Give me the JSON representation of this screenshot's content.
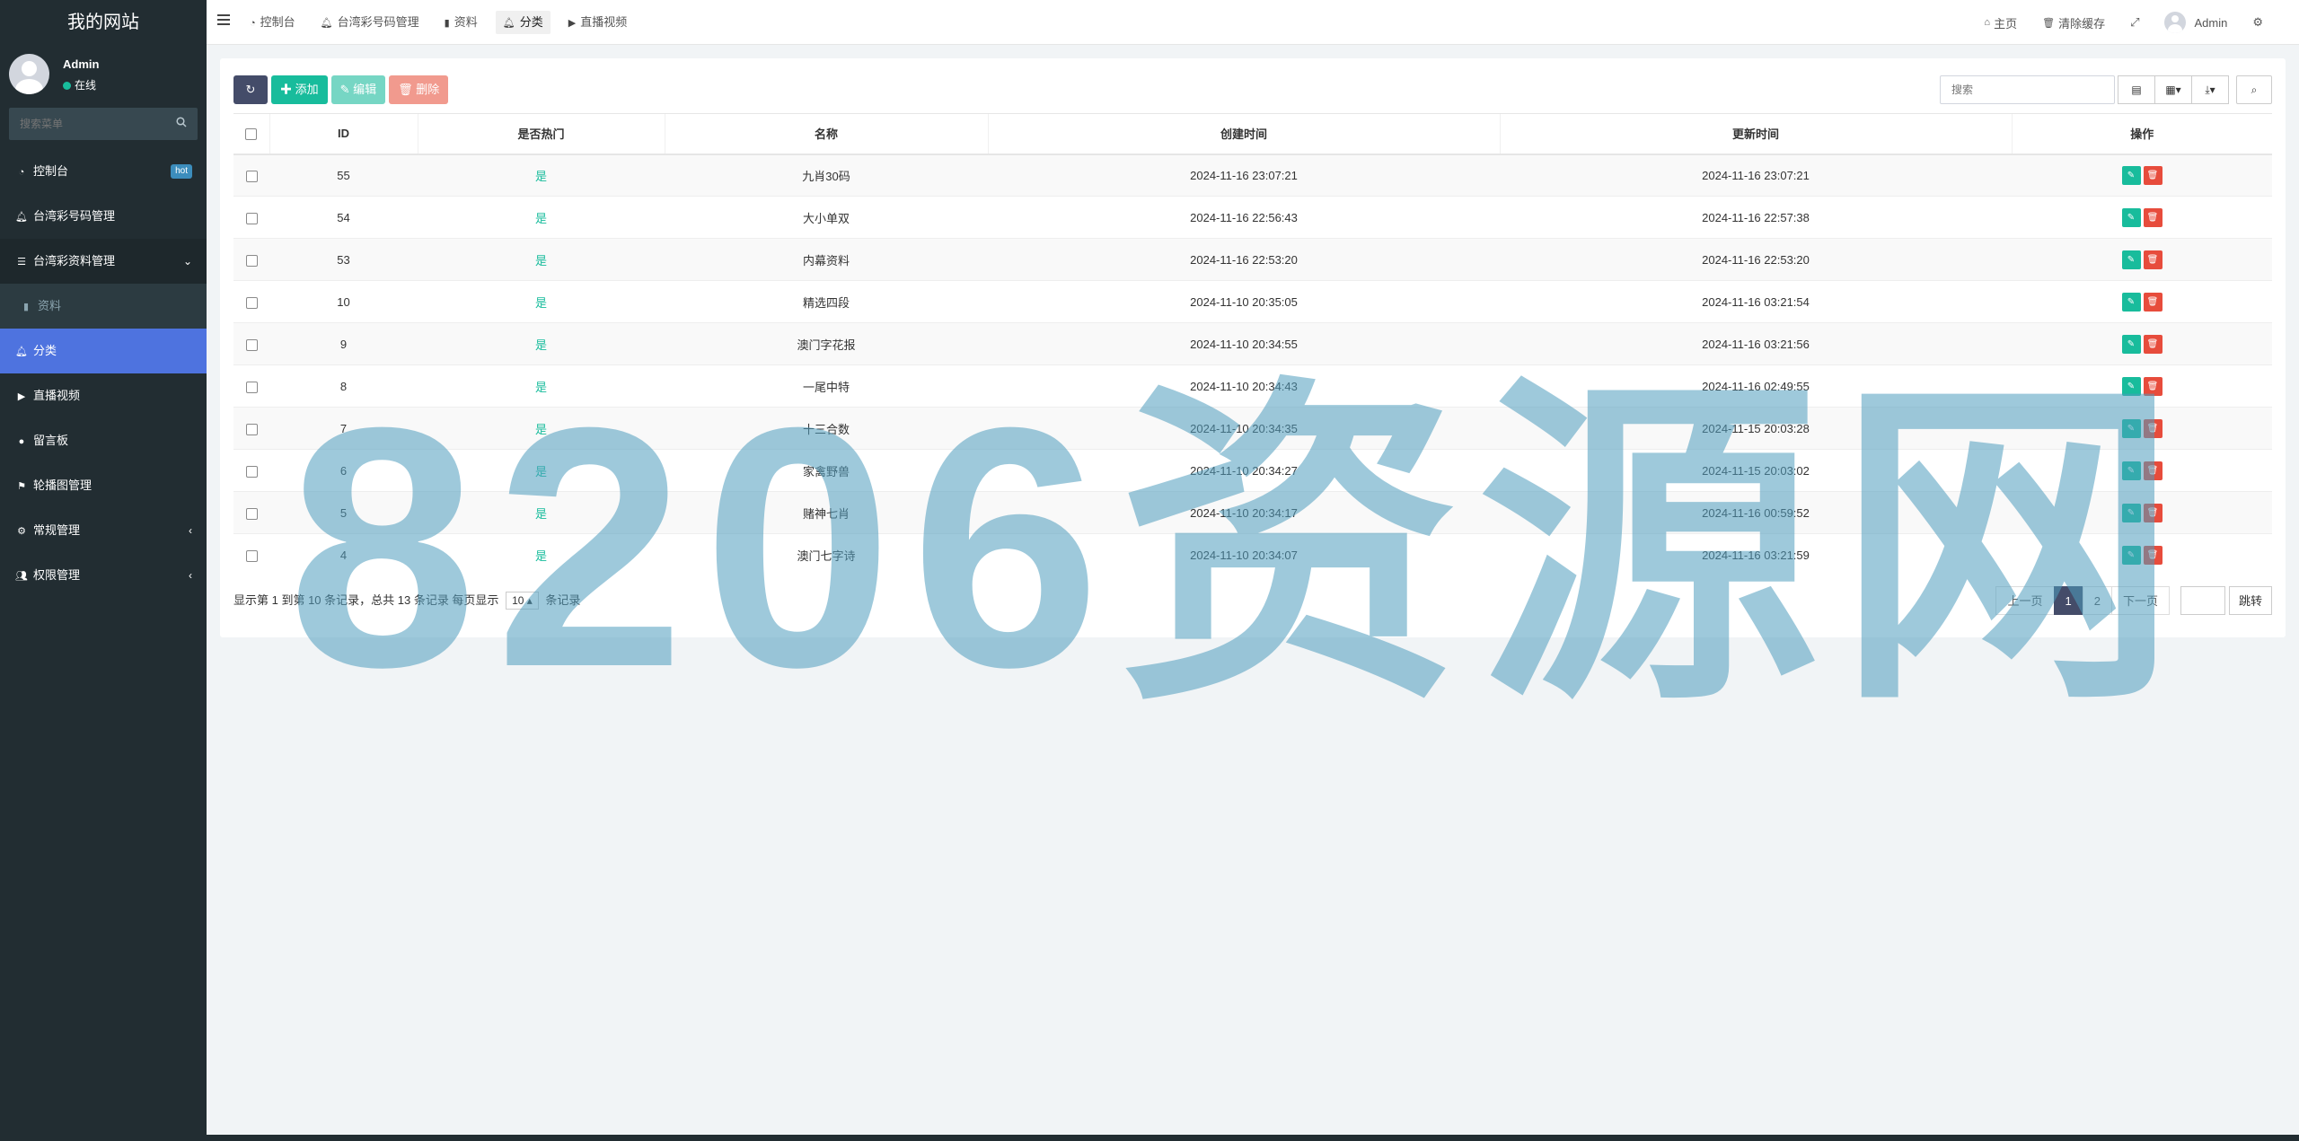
{
  "site_title": "我的网站",
  "user": {
    "name": "Admin",
    "status": "在线"
  },
  "sidebar": {
    "search_placeholder": "搜索菜单",
    "items": [
      {
        "label": "控制台",
        "icon": "dashboard-icon",
        "badge": "hot"
      },
      {
        "label": "台湾彩号码管理",
        "icon": "bell-icon"
      },
      {
        "label": "台湾彩资料管理",
        "icon": "list-icon",
        "expanded": true
      },
      {
        "label": "资料",
        "icon": "bookmark-icon"
      },
      {
        "label": "分类",
        "icon": "bell-icon",
        "active": true
      },
      {
        "label": "直播视频",
        "icon": "video-icon"
      },
      {
        "label": "留言板",
        "icon": "comment-icon"
      },
      {
        "label": "轮播图管理",
        "icon": "sliders-icon"
      },
      {
        "label": "常规管理",
        "icon": "cogs-icon"
      },
      {
        "label": "权限管理",
        "icon": "users-icon"
      }
    ]
  },
  "header": {
    "tabs": [
      {
        "label": "控制台",
        "icon": "dashboard-icon"
      },
      {
        "label": "台湾彩号码管理",
        "icon": "bell-icon"
      },
      {
        "label": "资料",
        "icon": "bookmark-icon"
      },
      {
        "label": "分类",
        "icon": "bell-icon",
        "active": true
      },
      {
        "label": "直播视频",
        "icon": "video-icon"
      }
    ],
    "home": "主页",
    "clear_cache": "清除缓存",
    "admin": "Admin"
  },
  "toolbar": {
    "add": "添加",
    "edit": "编辑",
    "delete": "删除",
    "search_placeholder": "搜索"
  },
  "table": {
    "columns": [
      "ID",
      "是否热门",
      "名称",
      "创建时间",
      "更新时间",
      "操作"
    ],
    "rows": [
      {
        "id": "55",
        "hot": "是",
        "name": "九肖30码",
        "created": "2024-11-16 23:07:21",
        "updated": "2024-11-16 23:07:21"
      },
      {
        "id": "54",
        "hot": "是",
        "name": "大小单双",
        "created": "2024-11-16 22:56:43",
        "updated": "2024-11-16 22:57:38"
      },
      {
        "id": "53",
        "hot": "是",
        "name": "内幕资料",
        "created": "2024-11-16 22:53:20",
        "updated": "2024-11-16 22:53:20"
      },
      {
        "id": "10",
        "hot": "是",
        "name": "精选四段",
        "created": "2024-11-10 20:35:05",
        "updated": "2024-11-16 03:21:54"
      },
      {
        "id": "9",
        "hot": "是",
        "name": "澳门字花报",
        "created": "2024-11-10 20:34:55",
        "updated": "2024-11-16 03:21:56"
      },
      {
        "id": "8",
        "hot": "是",
        "name": "一尾中特",
        "created": "2024-11-10 20:34:43",
        "updated": "2024-11-16 02:49:55"
      },
      {
        "id": "7",
        "hot": "是",
        "name": "十三合数",
        "created": "2024-11-10 20:34:35",
        "updated": "2024-11-15 20:03:28"
      },
      {
        "id": "6",
        "hot": "是",
        "name": "家禽野兽",
        "created": "2024-11-10 20:34:27",
        "updated": "2024-11-15 20:03:02"
      },
      {
        "id": "5",
        "hot": "是",
        "name": "赌神七肖",
        "created": "2024-11-10 20:34:17",
        "updated": "2024-11-16 00:59:52"
      },
      {
        "id": "4",
        "hot": "是",
        "name": "澳门七字诗",
        "created": "2024-11-10 20:34:07",
        "updated": "2024-11-16 03:21:59"
      }
    ]
  },
  "footer": {
    "info_prefix": "显示第 1 到第 10 条记录，总共 13 条记录 每页显示",
    "page_size": "10",
    "info_suffix": "条记录"
  },
  "pagination": {
    "prev": "上一页",
    "pages": [
      "1",
      "2"
    ],
    "current": "1",
    "next": "下一页",
    "jump": "跳转"
  },
  "watermark": "8206资源网"
}
